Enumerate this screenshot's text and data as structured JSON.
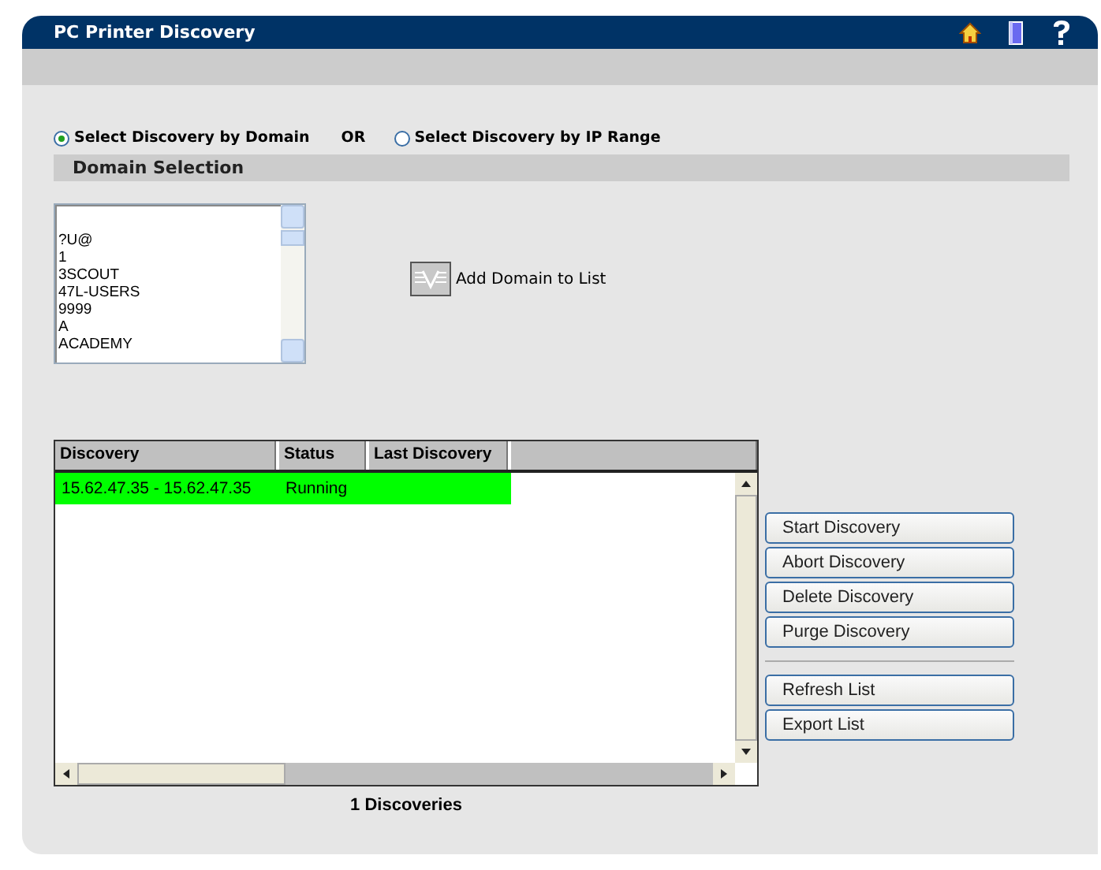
{
  "window": {
    "title": "PC Printer Discovery"
  },
  "mode_options": [
    {
      "label": "Select Discovery by Domain",
      "selected": true
    },
    {
      "label": "Select Discovery by IP Range",
      "selected": false
    }
  ],
  "mode_separator": "OR",
  "domain_section": {
    "title": "Domain Selection",
    "domains": [
      "?U@",
      "1",
      "3SCOUT",
      "47L-USERS",
      "9999",
      "A",
      "ACADEMY"
    ],
    "add_button": "Add Domain to List"
  },
  "table": {
    "columns": [
      "Discovery",
      "Status",
      "Last Discovery"
    ],
    "rows": [
      {
        "cells": [
          "15.62.47.35 - 15.62.47.35",
          "Running",
          ""
        ],
        "selected": true
      }
    ]
  },
  "discovery_count": "1 Discoveries",
  "button_groups": [
    [
      "Start Discovery",
      "Abort Discovery",
      "Delete Discovery",
      "Purge Discovery"
    ],
    [
      "Refresh List",
      "Export List"
    ]
  ]
}
